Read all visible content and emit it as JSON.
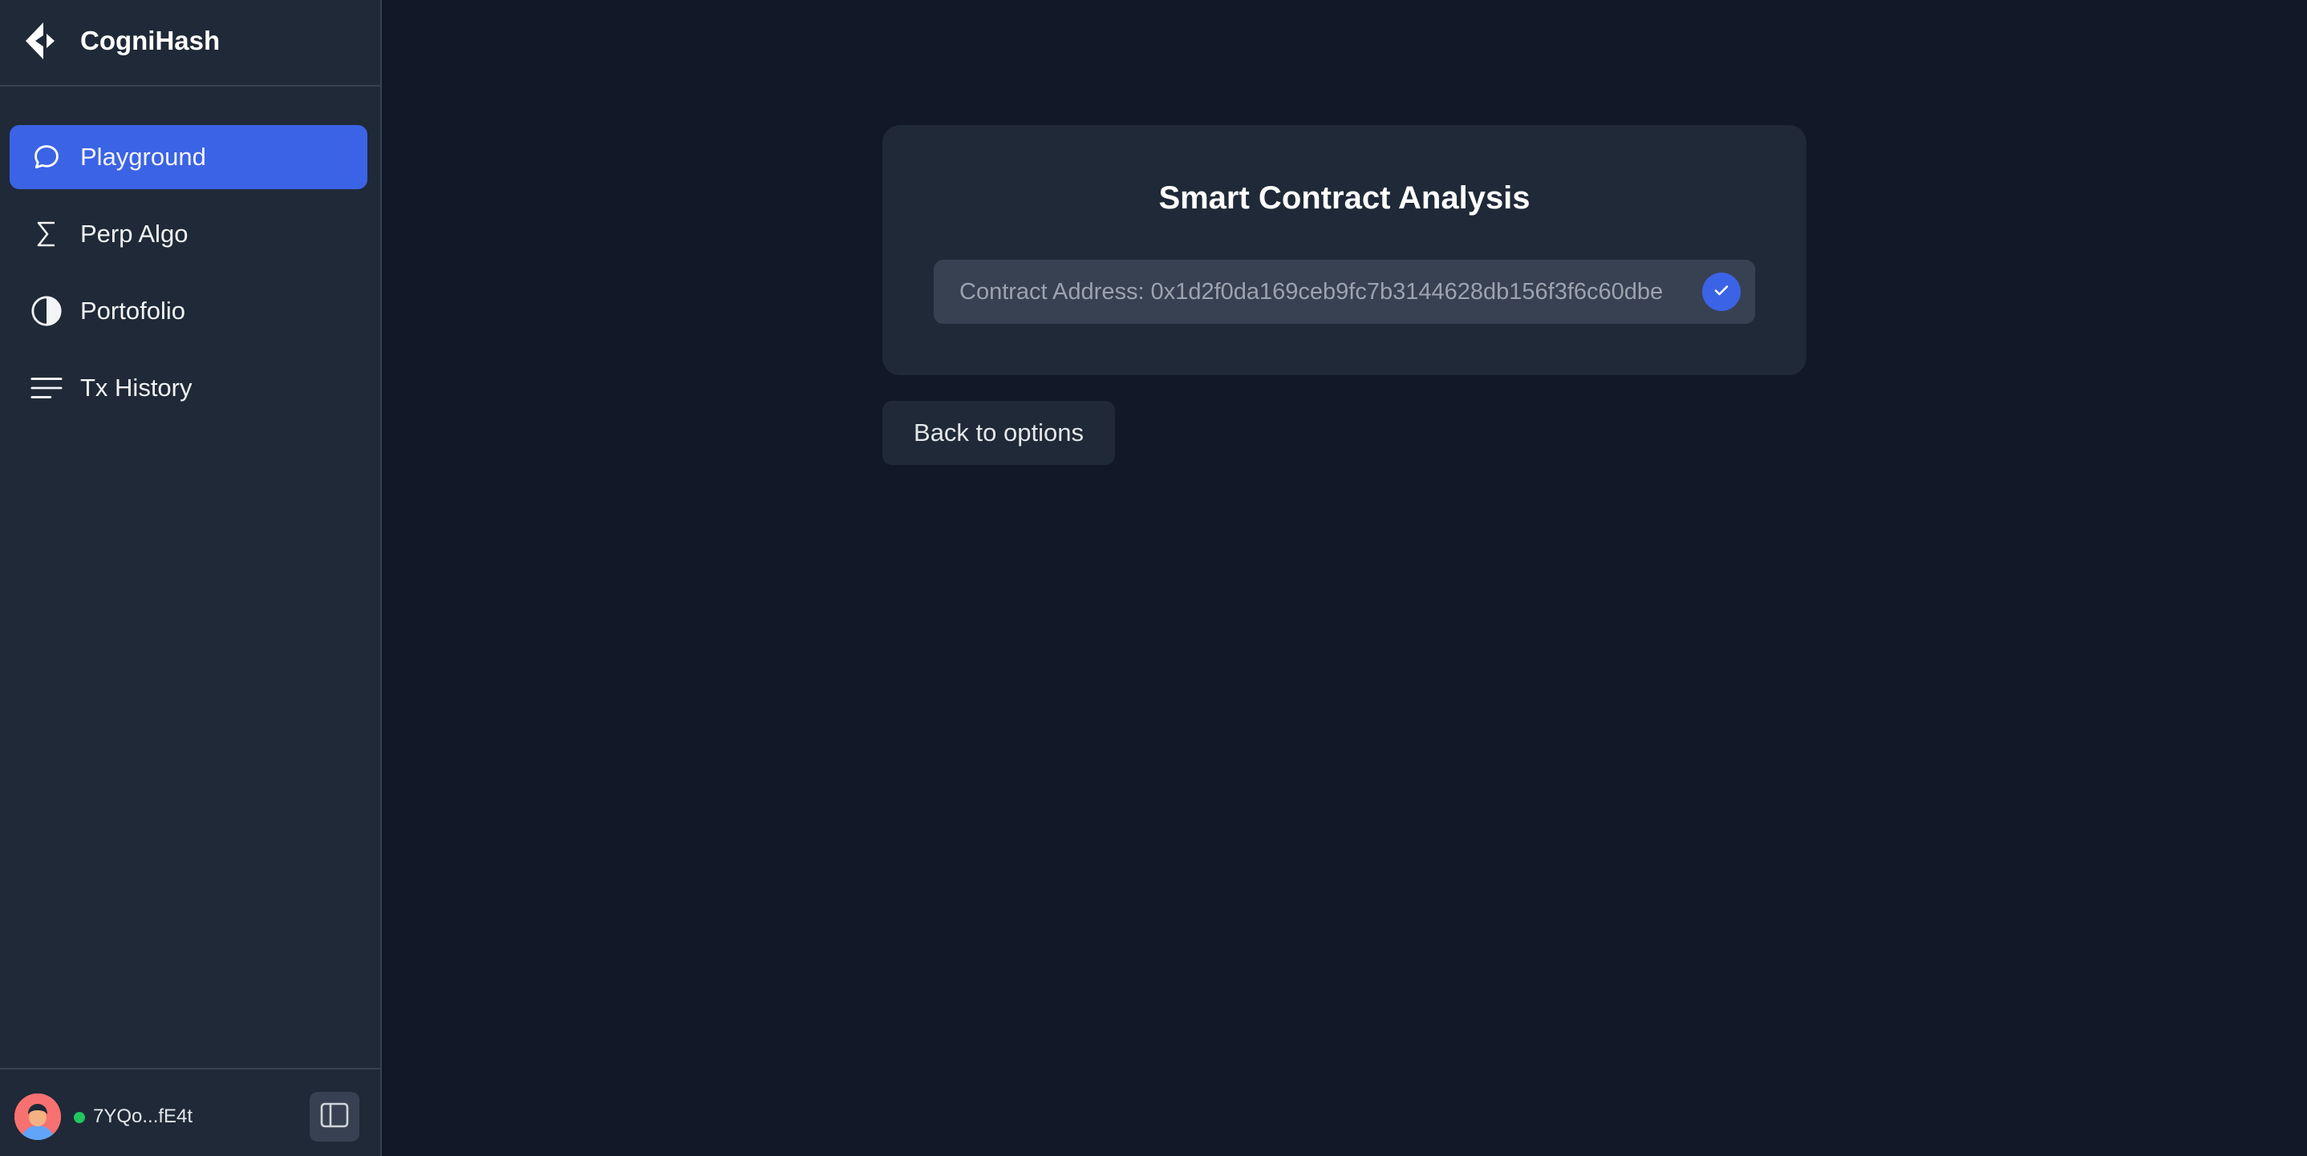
{
  "app": {
    "name": "CogniHash"
  },
  "sidebar": {
    "items": [
      {
        "label": "Playground",
        "icon": "chat-bubble-icon",
        "active": true
      },
      {
        "label": "Perp Algo",
        "icon": "sigma-icon",
        "active": false
      },
      {
        "label": "Portofolio",
        "icon": "half-circle-icon",
        "active": false
      },
      {
        "label": "Tx History",
        "icon": "lines-icon",
        "active": false
      }
    ],
    "footer": {
      "wallet": "7YQo...fE4t",
      "status_color": "#22c55e"
    }
  },
  "main": {
    "card_title": "Smart Contract Analysis",
    "address_field": "Contract Address: 0x1d2f0da169ceb9fc7b3144628db156f3f6c60dbe",
    "back_button": "Back to options"
  },
  "colors": {
    "accent": "#3b63e5",
    "background": "#111827",
    "panel": "#1f2937",
    "input": "#374151"
  }
}
